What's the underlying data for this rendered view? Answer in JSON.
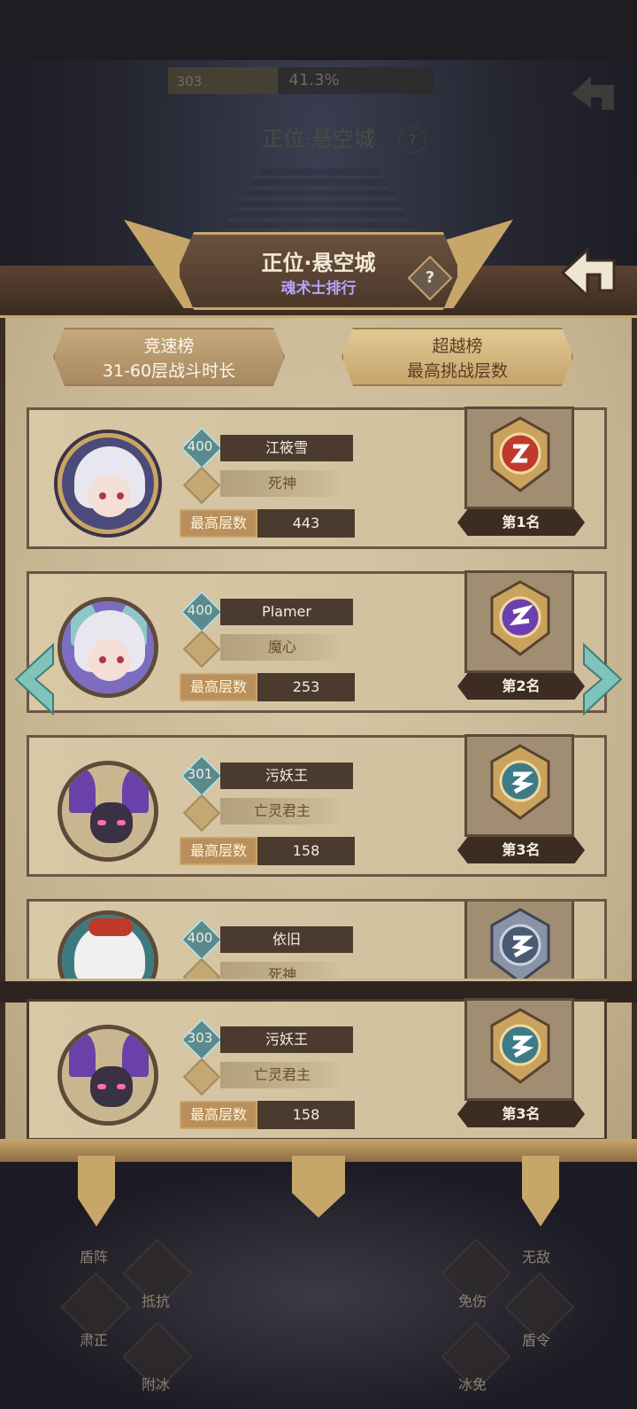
{
  "background": {
    "level": "303",
    "progress_text": "41.3%",
    "progress_value": 0.413,
    "title": "正位·悬空城",
    "help": "?"
  },
  "header": {
    "title": "正位·悬空城",
    "subtitle": "魂术士排行",
    "help": "?"
  },
  "tabs": [
    {
      "title": "竞速榜",
      "desc": "31-60层战斗时长",
      "selected": false
    },
    {
      "title": "超越榜",
      "desc": "最高挑战层数",
      "selected": true
    }
  ],
  "best_label": "最高层数",
  "ranks": [
    {
      "level": "400",
      "name": "江筱雪",
      "class": "死神",
      "best": "443",
      "rank": "第1名",
      "badge_color": "#c0392b"
    },
    {
      "level": "400",
      "name": "Plamer",
      "class": "魔心",
      "best": "253",
      "rank": "第2名",
      "badge_color": "#6c3fb0"
    },
    {
      "level": "301",
      "name": "污妖王",
      "class": "亡灵君主",
      "best": "158",
      "rank": "第3名",
      "badge_color": "#3d7b86"
    },
    {
      "level": "400",
      "name": "依旧",
      "class": "死神",
      "best": "",
      "rank": "",
      "badge_color": "#4a5a73"
    }
  ],
  "self_rank": {
    "level": "303",
    "name": "污妖王",
    "class": "亡灵君主",
    "best": "158",
    "rank": "第3名",
    "badge_color": "#3d7b86"
  },
  "bottom_labels": [
    "盾阵",
    "抵抗",
    "肃正",
    "附冰",
    "免伤",
    "盾令",
    "冰免",
    "无敌"
  ]
}
